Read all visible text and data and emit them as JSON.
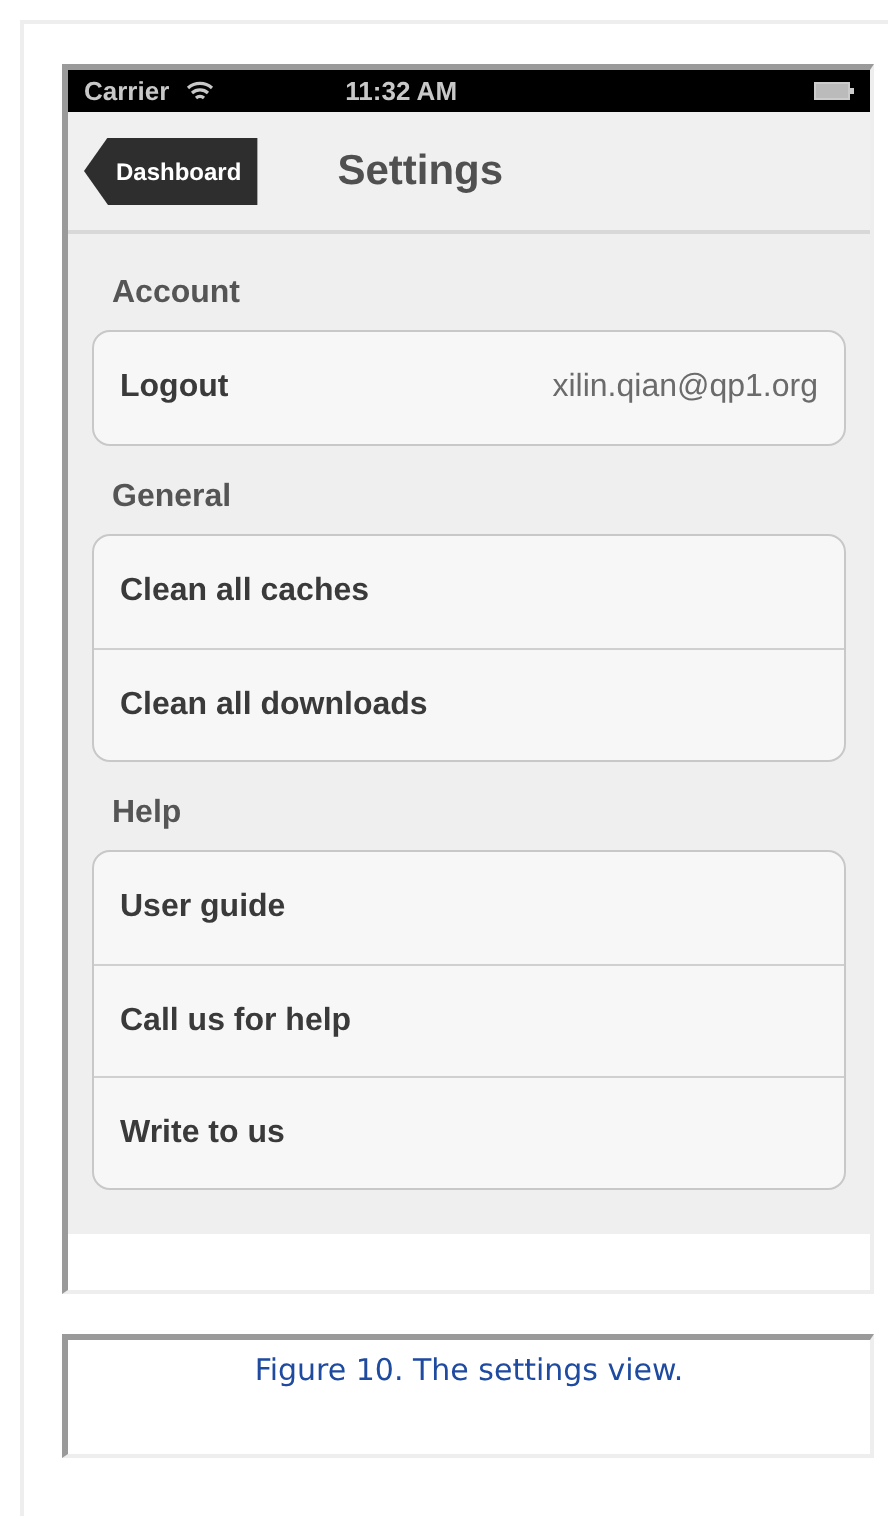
{
  "status_bar": {
    "carrier": "Carrier",
    "time": "11:32 AM"
  },
  "nav_bar": {
    "back_button": "Dashboard",
    "title": "Settings"
  },
  "sections": [
    {
      "header": "Account",
      "rows": [
        {
          "label": "Logout",
          "value": "xilin.qian@qp1.org"
        }
      ]
    },
    {
      "header": "General",
      "rows": [
        {
          "label": "Clean all caches"
        },
        {
          "label": "Clean all downloads"
        }
      ]
    },
    {
      "header": "Help",
      "rows": [
        {
          "label": "User guide"
        },
        {
          "label": "Call us for help"
        },
        {
          "label": "Write to us"
        }
      ]
    }
  ],
  "caption": "Figure 10. The settings view."
}
